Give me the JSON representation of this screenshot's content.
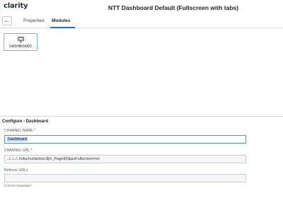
{
  "header": {
    "logo_text": "clarity",
    "page_title": "NTT Dashboard Default (Fullscreen with tabs)"
  },
  "tabs": [
    {
      "label": "Properties",
      "active": false
    },
    {
      "label": "Modules",
      "active": true
    }
  ],
  "back_icon": "arrow-left-icon",
  "modules": [
    {
      "label": "DASHBOARD",
      "icon": "dashboard-icon"
    }
  ],
  "config": {
    "title": "Configure - Dashboard",
    "channel_name": {
      "label": "CHANNEL NAME",
      "required_mark": "*",
      "value": "Dashboard"
    },
    "channel_url": {
      "label": "CHANNEL URL",
      "required_mark": "*",
      "value": "../../../../niku/nu#action:$(n_PageID)&puFullscreen=on"
    },
    "referrer_urls": {
      "label": "Referrer URLs",
      "value": "",
      "hint": "Comma Separated"
    }
  },
  "colors": {
    "accent": "#1a73c4",
    "selection": "#b7d2f0"
  }
}
